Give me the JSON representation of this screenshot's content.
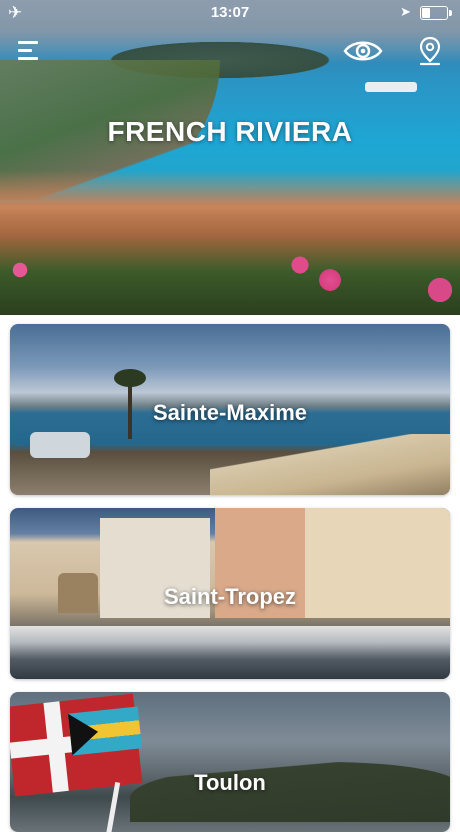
{
  "status_bar": {
    "airplane_icon": "airplane-icon",
    "time": "13:07",
    "location_icon": "location-arrow-icon",
    "battery_level": 0.35
  },
  "header": {
    "menu_icon": "hamburger-menu-icon",
    "eye_icon": "eye-icon",
    "map_pin_icon": "map-pin-icon",
    "title": "FRENCH RIVIERA"
  },
  "destinations": [
    {
      "label": "Sainte-Maxime"
    },
    {
      "label": "Saint-Tropez"
    },
    {
      "label": "Toulon"
    }
  ]
}
